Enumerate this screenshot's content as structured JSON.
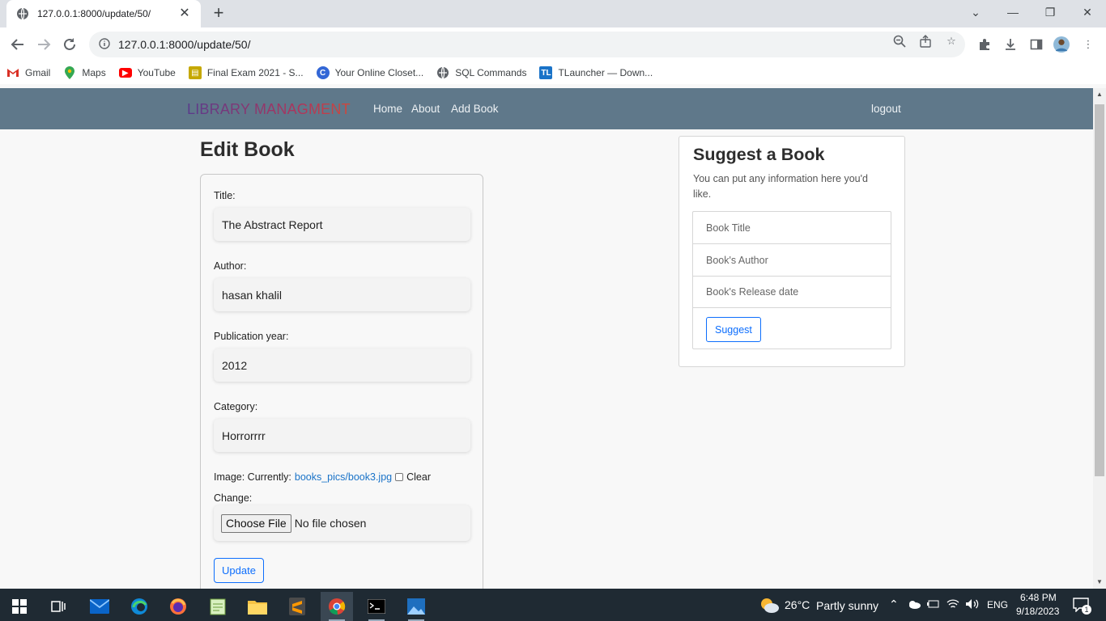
{
  "browser": {
    "tab_title": "127.0.0.1:8000/update/50/",
    "url": "127.0.0.1:8000/update/50/",
    "bookmarks": [
      {
        "label": "Gmail",
        "icon": "gmail-icon",
        "color": "#d93025"
      },
      {
        "label": "Maps",
        "icon": "maps-icon",
        "color": "#34a853"
      },
      {
        "label": "YouTube",
        "icon": "youtube-icon",
        "color": "#ff0000"
      },
      {
        "label": "Final Exam 2021 - S...",
        "icon": "doc-icon",
        "color": "#c5a800"
      },
      {
        "label": "Your Online Closet...",
        "icon": "closet-icon",
        "color": "#3367d6"
      },
      {
        "label": "SQL Commands",
        "icon": "globe-icon",
        "color": "#5f6368"
      },
      {
        "label": "TLauncher — Down...",
        "icon": "tl-icon",
        "color": "#1a73c8"
      }
    ]
  },
  "navbar": {
    "brand": "LIBRARY MANAGMENT",
    "links": [
      "Home",
      "About",
      "Add Book"
    ],
    "logout": "logout"
  },
  "form": {
    "heading": "Edit Book",
    "title_label": "Title:",
    "title_value": "The Abstract Report",
    "author_label": "Author:",
    "author_value": "hasan khalil",
    "year_label": "Publication year:",
    "year_value": "2012",
    "category_label": "Category:",
    "category_value": "Horrorrrr",
    "image_prefix": "Image: Currently:",
    "image_link": "books_pics/book3.jpg",
    "clear_label": "Clear",
    "change_label": "Change:",
    "file_button": "Choose File",
    "file_status": "No file chosen",
    "submit": "Update"
  },
  "sidebar": {
    "title": "Suggest a Book",
    "text": "You can put any information here you'd like.",
    "fields": [
      "Book Title",
      "Book's Author",
      "Book's Release date"
    ],
    "submit": "Suggest"
  },
  "taskbar": {
    "weather_temp": "26°C",
    "weather_desc": "Partly sunny",
    "lang": "ENG",
    "time": "6:48 PM",
    "date": "9/18/2023",
    "notif_count": "1"
  }
}
